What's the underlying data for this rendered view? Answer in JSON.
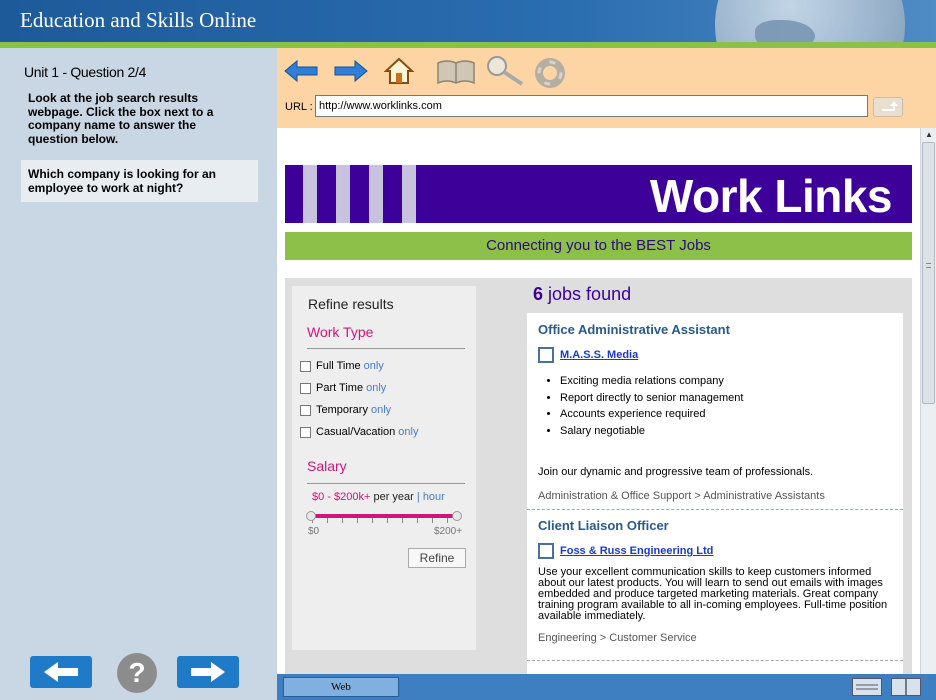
{
  "app": {
    "title": "Education and Skills Online"
  },
  "left_panel": {
    "question_number": "Unit 1 - Question 2/4",
    "instructions": "Look at the job search results webpage. Click the box next to a company name to answer the question below.",
    "question": "Which company is looking for an employee to work at night?"
  },
  "browser": {
    "url_label": "URL :",
    "url": "http://www.worklinks.com",
    "tab_label": "Web"
  },
  "site": {
    "name": "Work Links",
    "tagline": "Connecting you to the BEST Jobs",
    "refine": {
      "title": "Refine results",
      "work_type_heading": "Work Type",
      "options": [
        {
          "label": "Full Time",
          "only": "only"
        },
        {
          "label": "Part Time",
          "only": "only"
        },
        {
          "label": "Temporary",
          "only": "only"
        },
        {
          "label": "Casual/Vacation",
          "only": "only"
        }
      ],
      "salary_heading": "Salary",
      "salary_range": "$0 - $200k+",
      "per_year": "per year",
      "separator": "|",
      "hour": "hour",
      "slider_min": "$0",
      "slider_max": "$200+",
      "button": "Refine"
    },
    "results": {
      "count": "6",
      "count_suffix": "jobs found",
      "jobs": [
        {
          "title": "Office Administrative Assistant",
          "company": "M.A.S.S. Media",
          "bullets": [
            "Exciting media relations company",
            "Report directly to senior management",
            "Accounts experience required",
            "Salary negotiable"
          ],
          "description": "Join our dynamic and progressive team of professionals.",
          "category": "Administration & Office Support > Administrative Assistants"
        },
        {
          "title": "Client Liaison Officer",
          "company": "Foss & Russ Engineering Ltd",
          "description": "Use your excellent communication skills to keep customers informed about our latest products. You will learn to send out emails with images embedded and produce targeted marketing materials. Great company training program available to all in-coming employees. Full-time position available immediately.",
          "category": "Engineering > Customer Service"
        }
      ]
    }
  },
  "colors": {
    "banner": "#2a6db0",
    "accent_green": "#8cc049",
    "site_purple": "#3d0099",
    "pink": "#d0157c",
    "toolbar": "#fdd5a5"
  }
}
